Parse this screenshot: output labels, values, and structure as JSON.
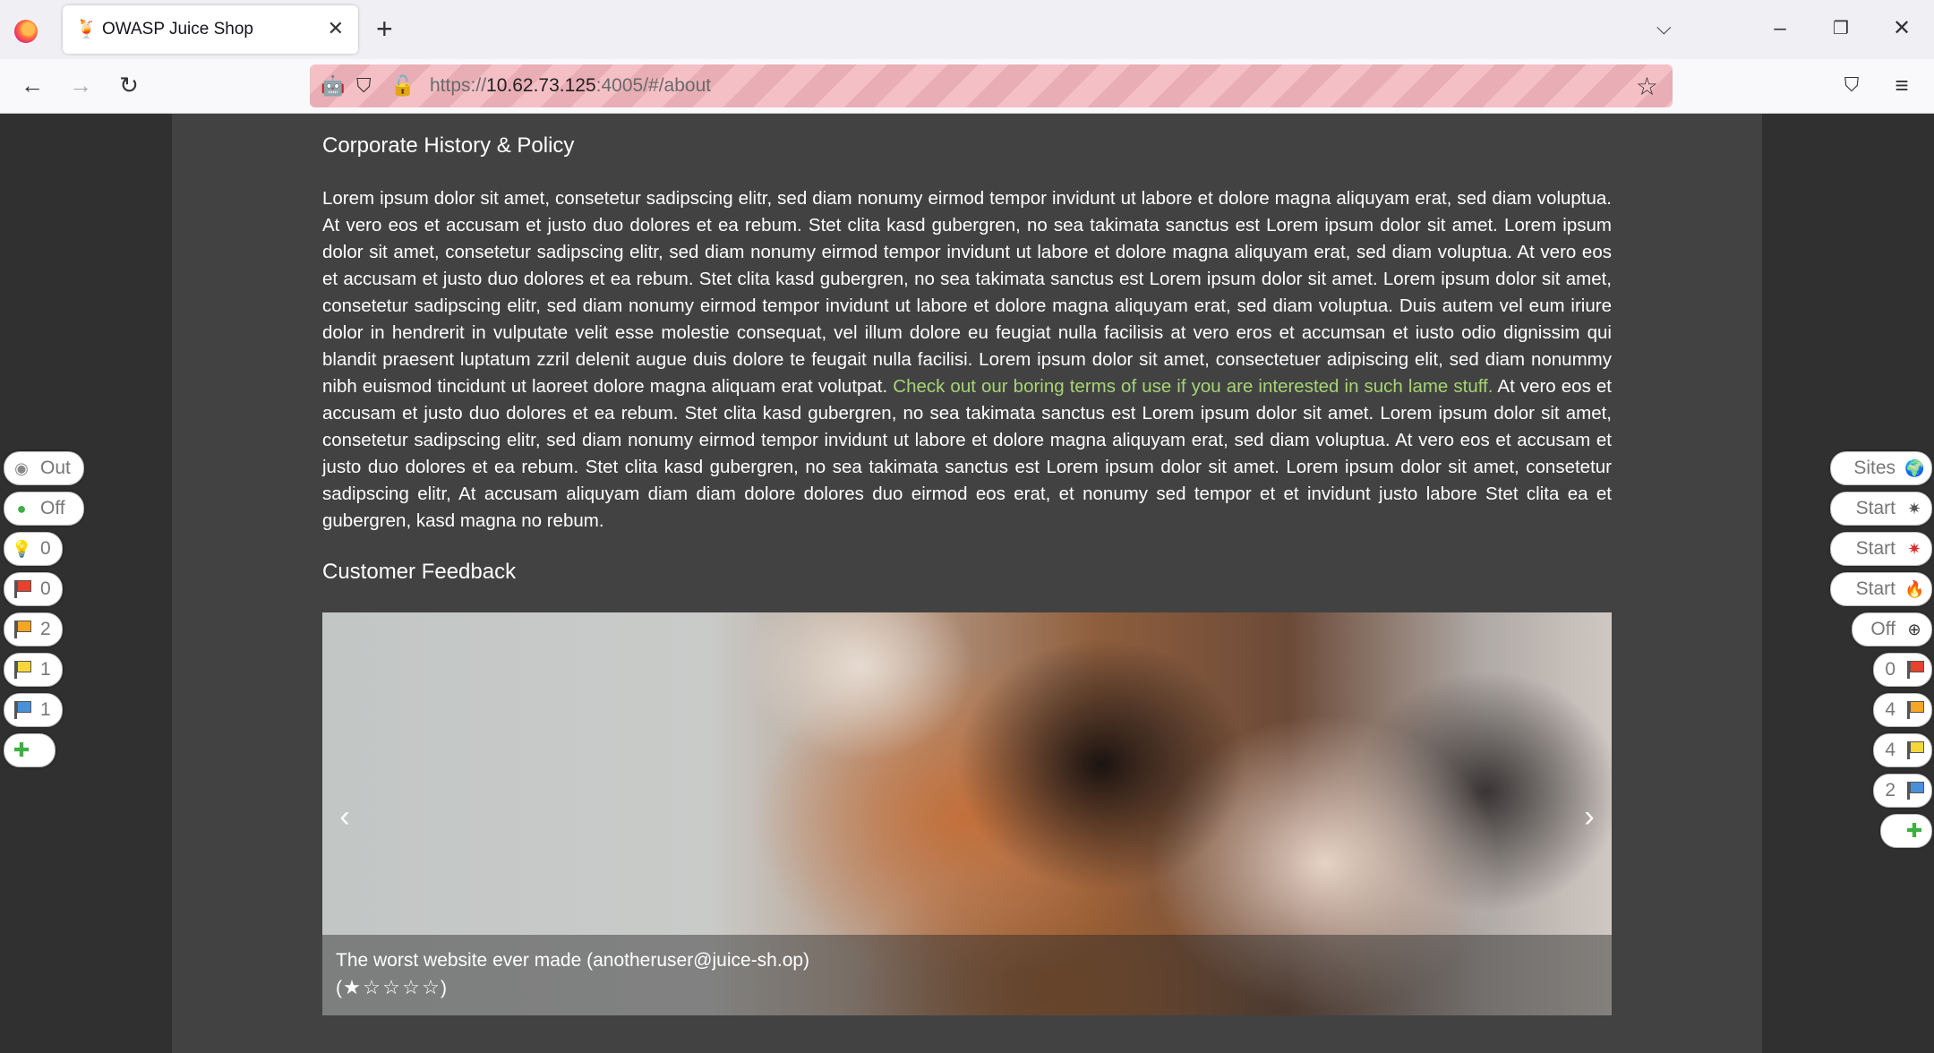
{
  "browser": {
    "tab_title": "OWASP Juice Shop",
    "url_prefix": "https://",
    "url_host": "10.62.73.125",
    "url_rest": ":4005/#/about"
  },
  "page": {
    "corporate_heading": "Corporate History & Policy",
    "paragraph_before_link": "Lorem ipsum dolor sit amet, consetetur sadipscing elitr, sed diam nonumy eirmod tempor invidunt ut labore et dolore magna aliquyam erat, sed diam voluptua. At vero eos et accusam et justo duo dolores et ea rebum. Stet clita kasd gubergren, no sea takimata sanctus est Lorem ipsum dolor sit amet. Lorem ipsum dolor sit amet, consetetur sadipscing elitr, sed diam nonumy eirmod tempor invidunt ut labore et dolore magna aliquyam erat, sed diam voluptua. At vero eos et accusam et justo duo dolores et ea rebum. Stet clita kasd gubergren, no sea takimata sanctus est Lorem ipsum dolor sit amet. Lorem ipsum dolor sit amet, consetetur sadipscing elitr, sed diam nonumy eirmod tempor invidunt ut labore et dolore magna aliquyam erat, sed diam voluptua. Duis autem vel eum iriure dolor in hendrerit in vulputate velit esse molestie consequat, vel illum dolore eu feugiat nulla facilisis at vero eros et accumsan et iusto odio dignissim qui blandit praesent luptatum zzril delenit augue duis dolore te feugait nulla facilisi. Lorem ipsum dolor sit amet, consectetuer adipiscing elit, sed diam nonummy nibh euismod tincidunt ut laoreet dolore magna aliquam erat volutpat.",
    "terms_link": "Check out our boring terms of use if you are interested in such lame stuff.",
    "paragraph_after_link": "At vero eos et accusam et justo duo dolores et ea rebum. Stet clita kasd gubergren, no sea takimata sanctus est Lorem ipsum dolor sit amet. Lorem ipsum dolor sit amet, consetetur sadipscing elitr, sed diam nonumy eirmod tempor invidunt ut labore et dolore magna aliquyam erat, sed diam voluptua. At vero eos et accusam et justo duo dolores et ea rebum. Stet clita kasd gubergren, no sea takimata sanctus est Lorem ipsum dolor sit amet. Lorem ipsum dolor sit amet, consetetur sadipscing elitr, At accusam aliquyam diam diam dolore dolores duo eirmod eos erat, et nonumy sed tempor et et invidunt justo labore Stet clita ea et gubergren, kasd magna no rebum.",
    "feedback_heading": "Customer Feedback",
    "feedback_caption": "The worst website ever made (anotheruser@juice-sh.op)",
    "rating_open": "(",
    "rating_close": ")",
    "rating": 1,
    "rating_max": 5,
    "prev_arrow": "‹",
    "next_arrow": "›"
  },
  "left_widgets": [
    {
      "label": "Out",
      "icon": "record-icon",
      "color": "#888888"
    },
    {
      "label": "Off",
      "icon": "green-dot-icon",
      "color": "#3cb043"
    },
    {
      "label": "0",
      "icon": "lightbulb-icon",
      "color": "#9ec5e8"
    },
    {
      "label": "0",
      "icon": "red-flag-icon",
      "color": "#e8412c"
    },
    {
      "label": "2",
      "icon": "orange-flag-icon",
      "color": "#f5a623"
    },
    {
      "label": "1",
      "icon": "yellow-flag-icon",
      "color": "#f6d63b"
    },
    {
      "label": "1",
      "icon": "blue-flag-icon",
      "color": "#4a90d9"
    },
    {
      "label": "",
      "icon": "plus-icon",
      "color": "#3cb043"
    }
  ],
  "right_widgets": [
    {
      "label": "Sites",
      "icon": "globe-icon",
      "color": "#3b8fd4"
    },
    {
      "label": "Start",
      "icon": "spider-icon",
      "color": "#555555"
    },
    {
      "label": "Start",
      "icon": "red-spider-icon",
      "color": "#d9302c"
    },
    {
      "label": "Start",
      "icon": "flame-icon",
      "color": "#777777"
    },
    {
      "label": "Off",
      "icon": "crosshair-icon",
      "color": "#333333"
    },
    {
      "label": "0",
      "icon": "red-flag-icon",
      "color": "#e8412c"
    },
    {
      "label": "4",
      "icon": "orange-flag-icon",
      "color": "#f5a623"
    },
    {
      "label": "4",
      "icon": "yellow-flag-icon",
      "color": "#f6d63b"
    },
    {
      "label": "2",
      "icon": "blue-flag-icon",
      "color": "#4a90d9"
    },
    {
      "label": "",
      "icon": "plus-icon",
      "color": "#3cb043"
    }
  ]
}
